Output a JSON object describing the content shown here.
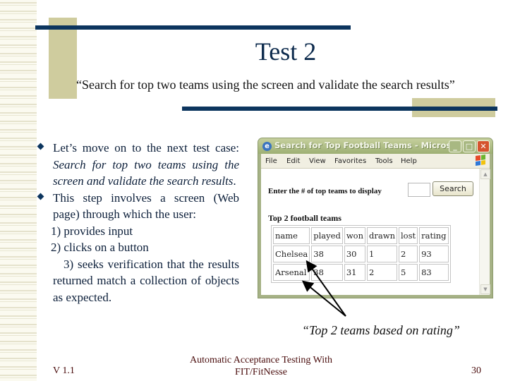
{
  "slide": {
    "title": "Test 2",
    "subtitle": "“Search for top two teams using the screen and validate the search results”",
    "bullets": [
      {
        "lead": "Let’s move on to the next test case: ",
        "italic": "Search for top two teams using the screen and validate the search results",
        "tail": "."
      },
      {
        "text": "This step involves a screen (Web page) through which the user:"
      }
    ],
    "steps": [
      "1)  provides input",
      "2)  clicks on a button",
      "3) seeks verification that the results returned match a collection of objects as expected."
    ],
    "caption": "“Top 2 teams based on rating”",
    "footer": {
      "version": "V 1.1",
      "center_line1": "Automatic Acceptance Testing With",
      "center_line2": "FIT/FitNesse",
      "page_number": "30"
    }
  },
  "browser": {
    "window_title": "Search for Top Football Teams - Micros...",
    "window_buttons": {
      "minimize": "_",
      "maximize": "□",
      "close": "✕"
    },
    "menu": [
      "File",
      "Edit",
      "View",
      "Favorites",
      "Tools",
      "Help"
    ],
    "form": {
      "label": "Enter the # of top teams to display",
      "input_value": "",
      "search_button": "Search"
    },
    "results_heading": "Top 2 football teams",
    "table": {
      "headers": [
        "name",
        "played",
        "won",
        "drawn",
        "lost",
        "rating"
      ],
      "rows": [
        [
          "Chelsea",
          "38",
          "30",
          "1",
          "2",
          "93"
        ],
        [
          "Arsenal",
          "38",
          "31",
          "2",
          "5",
          "83"
        ]
      ]
    }
  },
  "colors": {
    "title_navy": "#0c355e",
    "accent_khaki": "#cfcc9e",
    "footer_text": "#4a0d0d"
  }
}
